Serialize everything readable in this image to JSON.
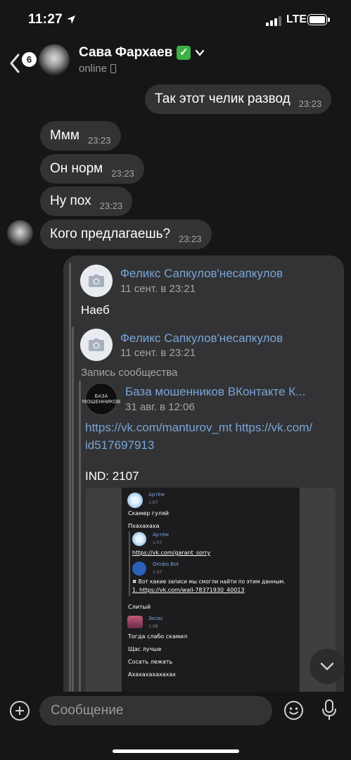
{
  "status_bar": {
    "time": "11:27",
    "network": "LTE"
  },
  "header": {
    "back_badge": "6",
    "contact_name": "Сава Фархаев",
    "verified_glyph": "✓",
    "presence": "online"
  },
  "messages": [
    {
      "side": "out",
      "text": "Так этот челик развод",
      "time": "23:23"
    },
    {
      "side": "in",
      "text": "Ммм",
      "time": "23:23"
    },
    {
      "side": "in",
      "text": "Он норм",
      "time": "23:23"
    },
    {
      "side": "in",
      "text": "Ну пох",
      "time": "23:23"
    },
    {
      "side": "in",
      "text": "Кого предлагаешь?",
      "time": "23:23"
    }
  ],
  "forward": {
    "author": "Феликс Сапкулов'несапкулов",
    "date": "11 сент. в 23:21",
    "text": "Наеб",
    "nested": {
      "author": "Феликс Сапкулов'несапкулов",
      "date": "11 сент. в 23:21",
      "label": "Запись сообщества",
      "post": {
        "community": "База мошенников ВКонтакте  К...",
        "community_avatar_text": "БАЗА МОШЕННИКОВ",
        "date": "31 авг. в 12:06",
        "link_line1": "https://vk.com/manturov_mt https://vk.com/",
        "link_line2": "id517697913",
        "ind": "IND: 2107"
      }
    }
  },
  "screenshot": {
    "m1_name": "Артём",
    "m1_time": "1:07",
    "m1_text": "Скамер гуляй",
    "m2_text": "Пхахахаха",
    "q1_name": "Артём",
    "q1_time": "1:07",
    "q1_link": "https://vk.com/garant_sorry",
    "q2_name": "Omibo Bot",
    "q2_time": "1:07",
    "q2_text": "✖ Вот какие записи мы смогли найти по этим данным.",
    "q2_link": "1. https://vk.com/wall-78371930_40013",
    "m3_text": "Слитый",
    "m4_name": "Эксвс",
    "m4_time": "1:08",
    "m4_text": "Тогда слабо скамил",
    "m5_text": "Щас лучше",
    "m6_text": "Сосать лежать",
    "m7_text": "Ахахахахахахах"
  },
  "composer": {
    "placeholder": "Сообщение"
  },
  "colors": {
    "bubble": "#333335",
    "link": "#79a5d8",
    "verified": "#3cb043",
    "background": "#161616"
  },
  "icons": [
    "location-arrow-icon",
    "signal-icon",
    "battery-icon",
    "back-arrow-icon",
    "verified-check-icon",
    "chevron-down-icon",
    "mobile-phone-icon",
    "camera-icon",
    "scroll-down-icon",
    "plus-icon",
    "emoji-icon",
    "microphone-icon"
  ]
}
